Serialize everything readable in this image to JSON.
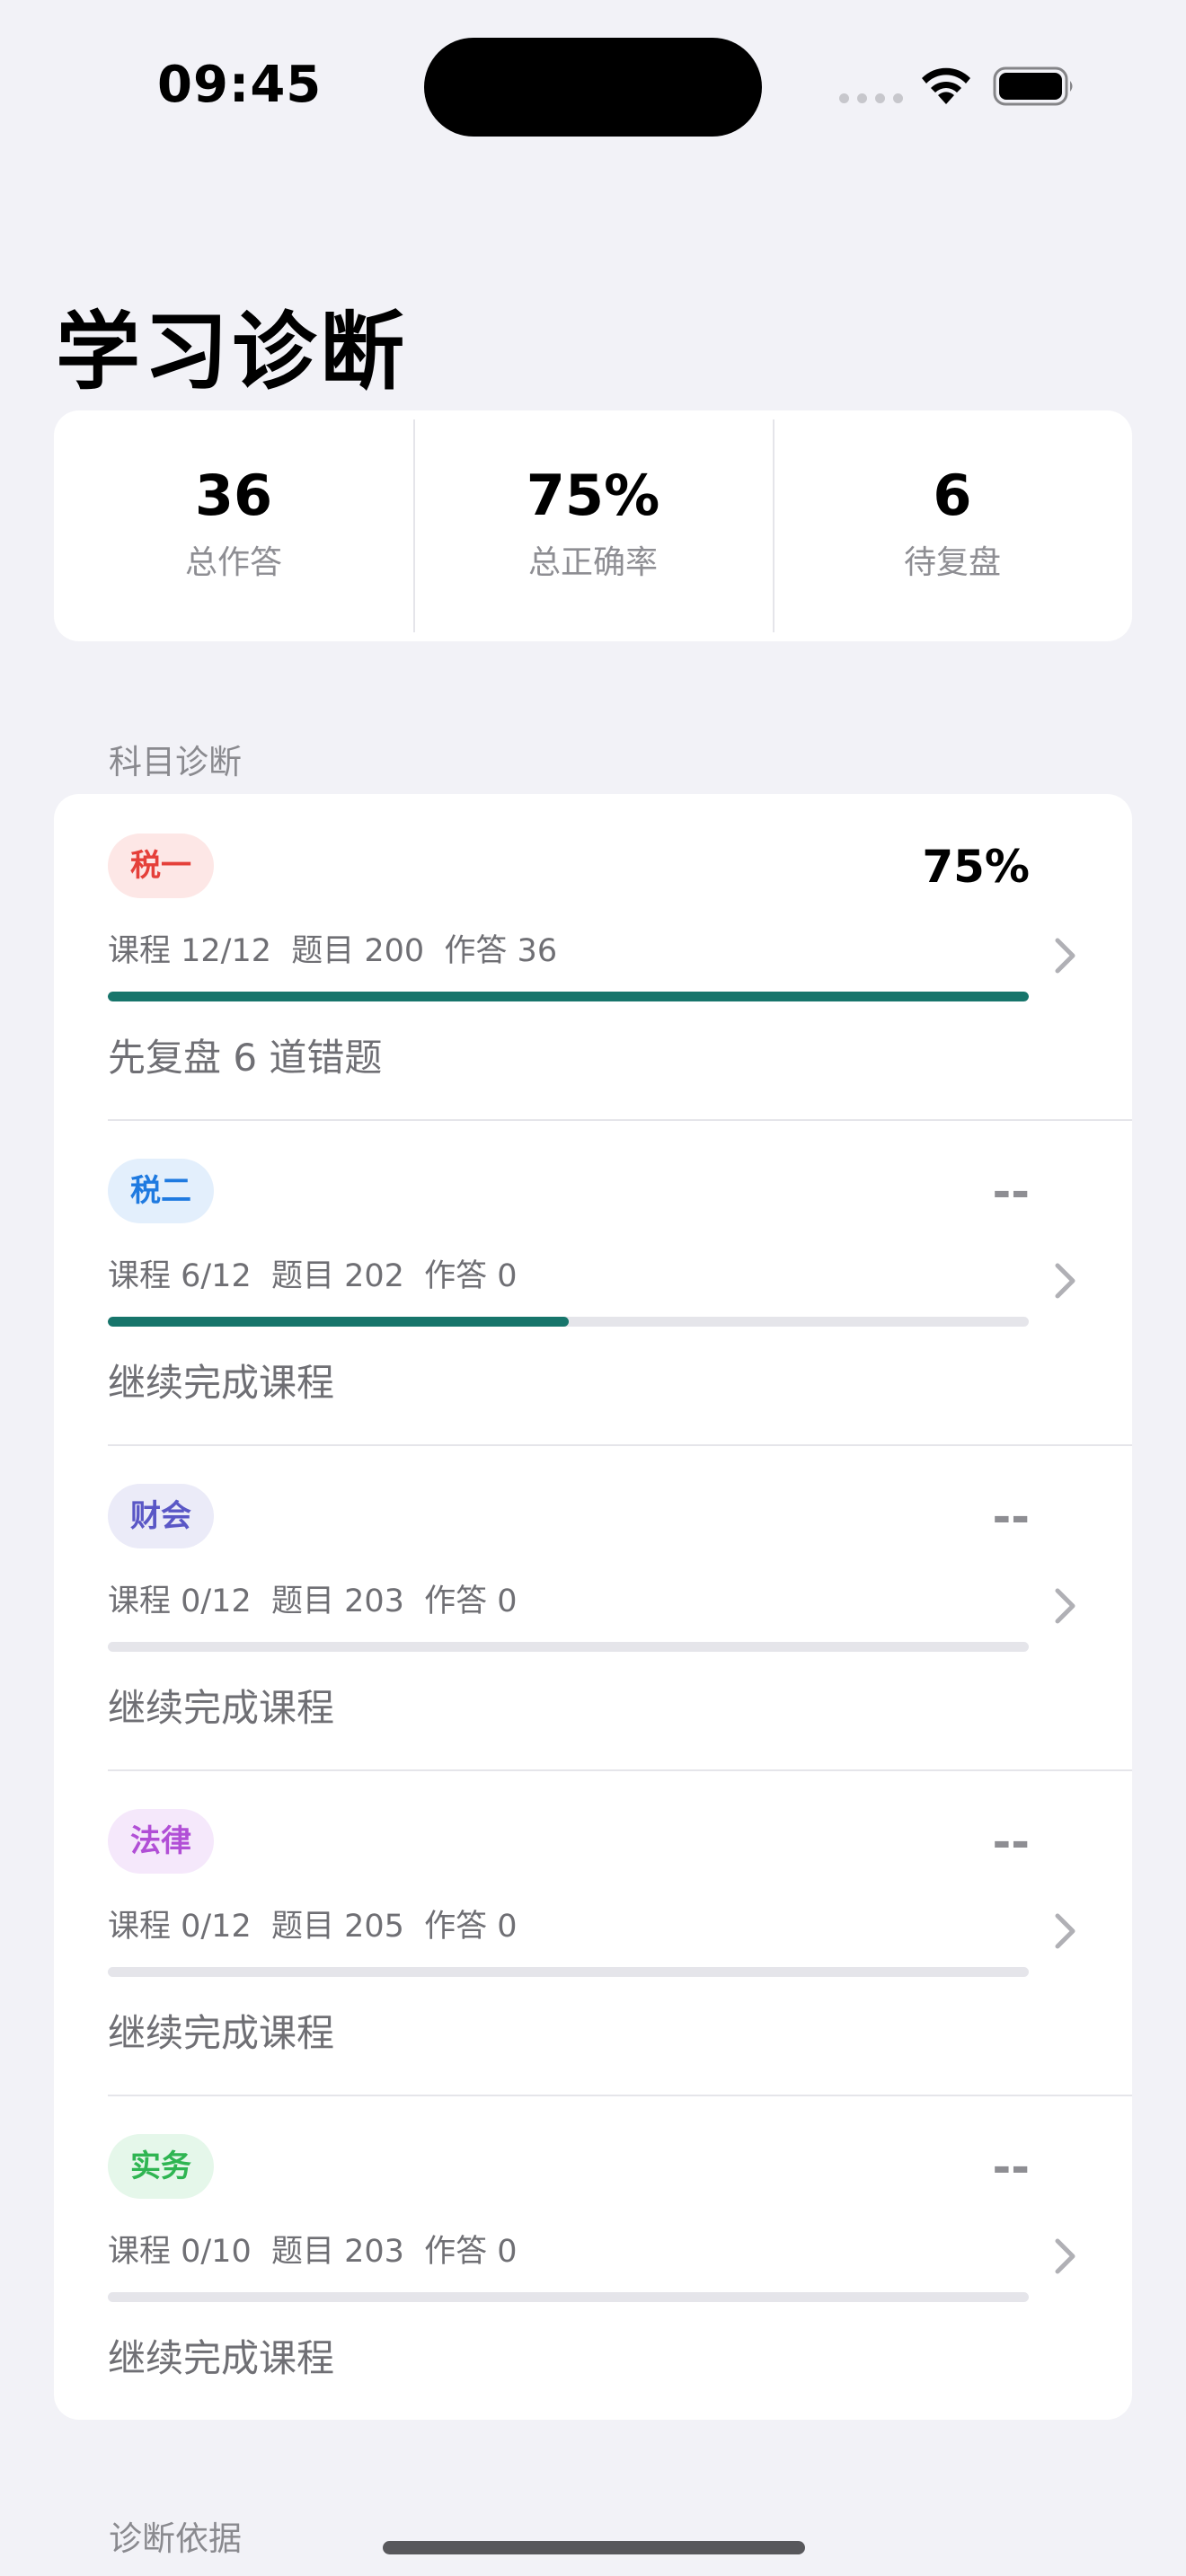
{
  "status_bar": {
    "time": "09:45"
  },
  "page": {
    "title": "学习诊断"
  },
  "stats": [
    {
      "value": "36",
      "label": "总作答"
    },
    {
      "value": "75%",
      "label": "总正确率"
    },
    {
      "value": "6",
      "label": "待复盘"
    }
  ],
  "sections": {
    "subjects": "科目诊断",
    "basis": "诊断依据"
  },
  "subjects": [
    {
      "tag": "税一",
      "tag_color": "#e5403a",
      "tag_bg": "#fde7e6",
      "accuracy": "75%",
      "accuracy_muted": false,
      "meta": "课程 12/12  题目 200  作答 36",
      "progress": 1.0,
      "advice": "先复盘 6 道错题"
    },
    {
      "tag": "税二",
      "tag_color": "#1f7ae0",
      "tag_bg": "#e3effc",
      "accuracy": "--",
      "accuracy_muted": true,
      "meta": "课程 6/12  题目 202  作答 0",
      "progress": 0.5,
      "advice": "继续完成课程"
    },
    {
      "tag": "财会",
      "tag_color": "#5a57c6",
      "tag_bg": "#ebebf8",
      "accuracy": "--",
      "accuracy_muted": true,
      "meta": "课程 0/12  题目 203  作答 0",
      "progress": 0.0,
      "advice": "继续完成课程"
    },
    {
      "tag": "法律",
      "tag_color": "#b14fd6",
      "tag_bg": "#f5e8fb",
      "accuracy": "--",
      "accuracy_muted": true,
      "meta": "课程 0/12  题目 205  作答 0",
      "progress": 0.0,
      "advice": "继续完成课程"
    },
    {
      "tag": "实务",
      "tag_color": "#2fb552",
      "tag_bg": "#e5f7ea",
      "accuracy": "--",
      "accuracy_muted": true,
      "meta": "课程 0/10  题目 203  作答 0",
      "progress": 0.0,
      "advice": "继续完成课程"
    }
  ]
}
